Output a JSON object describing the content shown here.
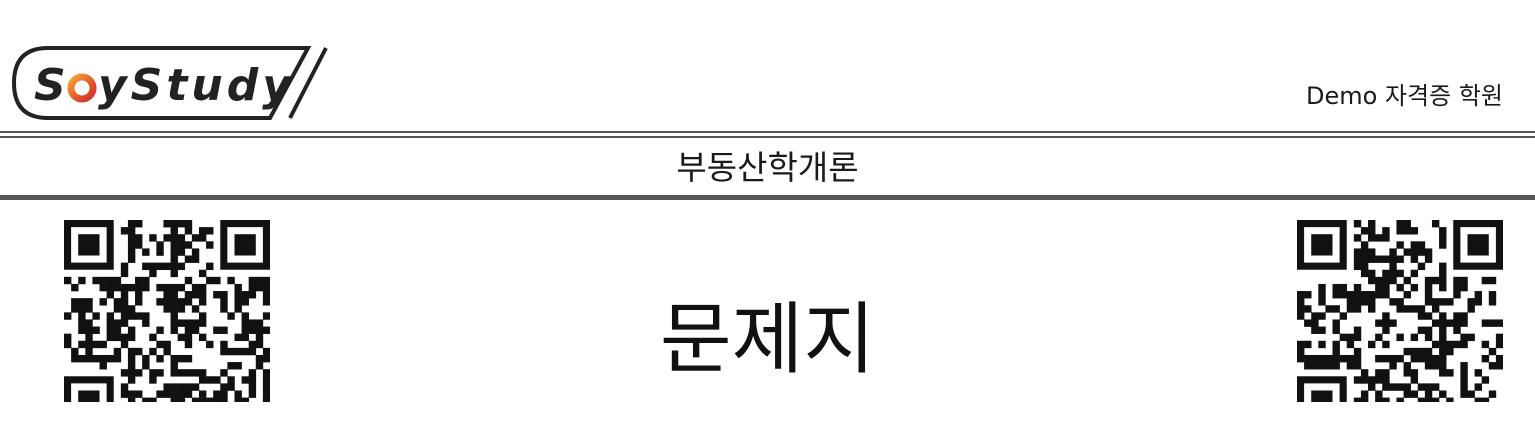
{
  "header": {
    "logo_text": "SoyStudy",
    "academy_name": "Demo 자격증 학원"
  },
  "subject": "부동산학개론",
  "document_type": "문제지",
  "colors": {
    "rule": "#555555",
    "logo_outline": "#222222",
    "logo_accent_orange": "#e8632b",
    "logo_accent_red": "#c9302c"
  },
  "icons": {
    "left_qr": "qr-code-icon",
    "right_qr": "qr-code-icon"
  }
}
